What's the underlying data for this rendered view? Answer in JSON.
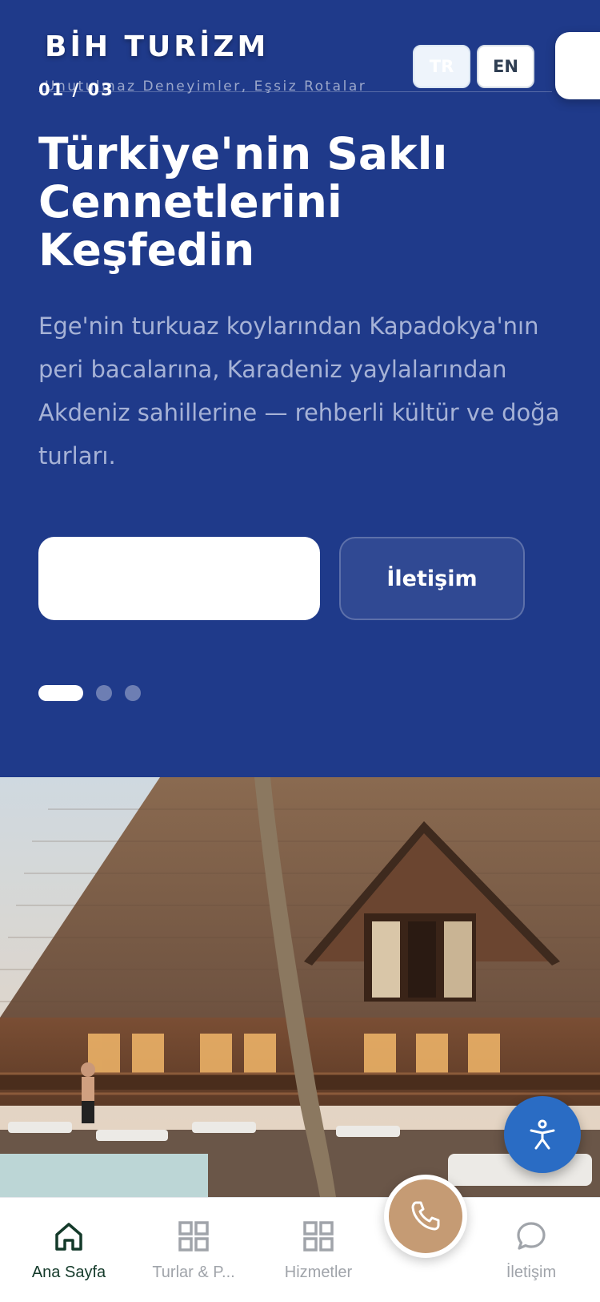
{
  "header": {
    "brand": "BİH TURİZM",
    "tagline": "Unutulmaz Deneyimler, Eşsiz Rotalar",
    "languages": [
      "TR",
      "EN"
    ],
    "active_language": "TR"
  },
  "hero": {
    "slide_counter": "01 / 03",
    "title": "Türkiye'nin Saklı Cennetlerini Keşfedin",
    "description": "Ege'nin turkuaz koylarından Kapadokya'nın peri bacalarına, Karadeniz yaylalarından Akdeniz sahillerine — rehberli kültür ve doğa turları.",
    "primary_cta_label": "",
    "secondary_cta_label": "İletişim",
    "slide_count": 3,
    "active_slide": 1
  },
  "bottom_nav": {
    "items": [
      {
        "label": "Ana Sayfa",
        "icon": "home-icon",
        "active": true
      },
      {
        "label": "Turlar & P...",
        "icon": "grid-icon",
        "active": false
      },
      {
        "label": "Hizmetler",
        "icon": "grid-icon",
        "active": false
      },
      {
        "label": "İletişim",
        "icon": "chat-bubble-icon",
        "active": false
      }
    ],
    "call_icon": "phone-icon"
  },
  "colors": {
    "hero_background": "#1f3a8a",
    "accent_call": "#c59b74",
    "accessibility_button": "#2a6cc4",
    "nav_active": "#143a2a"
  }
}
